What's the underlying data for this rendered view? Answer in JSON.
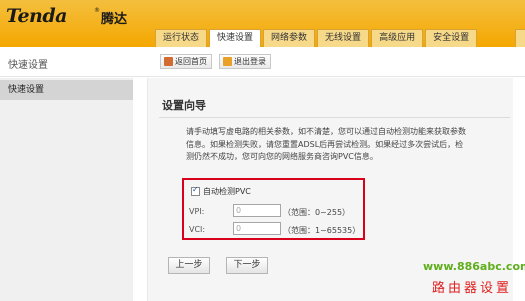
{
  "brand": {
    "logo": "Tenda",
    "registered": "®",
    "name_cn": "腾达"
  },
  "nav": {
    "tabs": [
      {
        "label": "运行状态",
        "active": false
      },
      {
        "label": "快速设置",
        "active": true
      },
      {
        "label": "网络参数",
        "active": false
      },
      {
        "label": "无线设置",
        "active": false
      },
      {
        "label": "高级应用",
        "active": false
      },
      {
        "label": "安全设置",
        "active": false
      }
    ]
  },
  "toolbar": {
    "home_label": "返回首页",
    "logout_label": "退出登录"
  },
  "sidebar": {
    "title": "快速设置",
    "items": [
      {
        "label": "快速设置",
        "selected": true
      }
    ]
  },
  "main": {
    "title": "设置向导",
    "description": "请手动填写虚电路的相关参数，如不清楚，您可以通过自动检测功能来获取参数信息。如果检测失败，请您重置ADSL后再尝试检测。如果经过多次尝试后，检测仍然不成功，您可向您的网络服务商咨询PVC信息。",
    "auto_detect": {
      "label": "自动检测PVC",
      "checked": true
    },
    "vpi": {
      "label": "VPI:",
      "value": "0",
      "hint": "（范围：0~255）"
    },
    "vci": {
      "label": "VCI:",
      "value": "0",
      "hint": "（范围：1~65535）"
    },
    "prev_label": "上一步",
    "next_label": "下一步"
  },
  "watermark": {
    "url": "www.886abc.com",
    "text": "路由器设置"
  },
  "colors": {
    "header": "#f4a700",
    "highlight_box": "#d9001b",
    "watermark_url": "#5fae1c",
    "watermark_text": "#e02020"
  }
}
